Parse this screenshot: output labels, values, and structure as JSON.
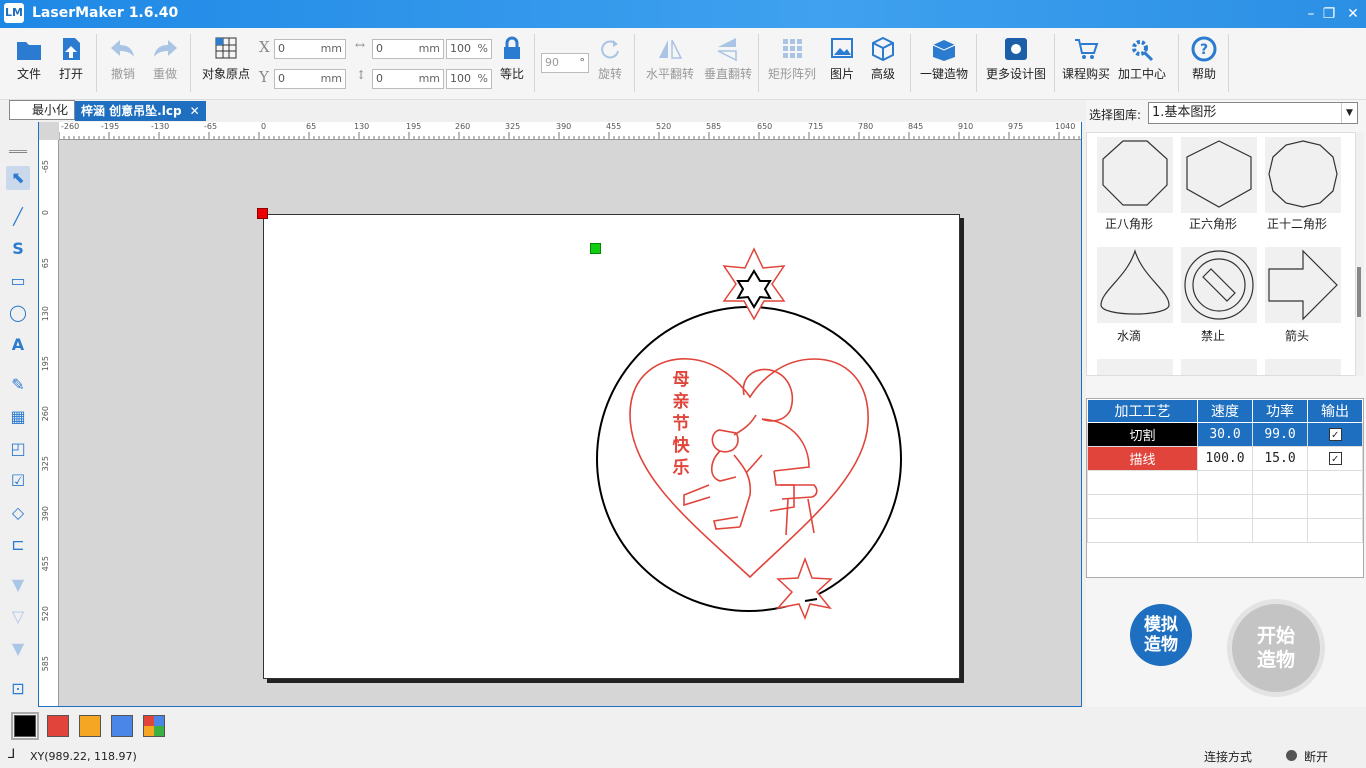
{
  "window": {
    "app_logo": "LM",
    "title": "LaserMaker 1.6.40",
    "minimize": "–",
    "restore": "❐",
    "close": "✕"
  },
  "toolbar": {
    "file": "文件",
    "open": "打开",
    "undo": "撤销",
    "redo": "重做",
    "origin": "对象原点",
    "x_label": "X",
    "y_label": "Y",
    "x_value": "0",
    "y_value": "0",
    "unit": "mm",
    "w_value": "0",
    "h_value": "0",
    "w_pct": "100",
    "h_pct": "100",
    "pct": "%",
    "ratio": "等比",
    "angle": "90",
    "angle_unit": "°",
    "rotate": "旋转",
    "hflip": "水平翻转",
    "vflip": "垂直翻转",
    "array": "矩形阵列",
    "image": "图片",
    "advanced": "高级",
    "oneclick": "一键造物",
    "more_designs": "更多设计图",
    "course": "课程购买",
    "center": "加工中心",
    "help": "帮助"
  },
  "tooltip": "最小化",
  "tab": {
    "title": "梓涵 创意吊坠.lcp",
    "close": "✕"
  },
  "ruler": {
    "h": [
      "-260",
      "-195",
      "-130",
      "-65",
      "0",
      "65",
      "130",
      "195",
      "260",
      "325",
      "390",
      "455",
      "520",
      "585",
      "650",
      "715",
      "780",
      "845",
      "910",
      "975",
      "1040"
    ],
    "v": [
      "-65",
      "0",
      "65",
      "130",
      "195",
      "260",
      "325",
      "390",
      "455",
      "520",
      "585"
    ]
  },
  "artwork": {
    "vertical_text": [
      "母",
      "亲",
      "节",
      "快",
      "乐"
    ],
    "black": "#000000",
    "red": "#e0443a"
  },
  "library": {
    "label": "选择图库:",
    "selected": "1.基本图形",
    "shapes": [
      "正八角形",
      "正六角形",
      "正十二角形",
      "水滴",
      "禁止",
      "箭头"
    ]
  },
  "process": {
    "headers": [
      "加工工艺",
      "速度",
      "功率",
      "输出"
    ],
    "rows": [
      {
        "name": "切割",
        "speed": "30.0",
        "power": "99.0",
        "output": "✓",
        "color": "#000000"
      },
      {
        "name": "描线",
        "speed": "100.0",
        "power": "15.0",
        "output": "✓",
        "color": "#e0443a"
      }
    ]
  },
  "buttons": {
    "simulate_1": "模拟",
    "simulate_2": "造物",
    "start_1": "开始",
    "start_2": "造物"
  },
  "colors": [
    "#000000",
    "#e0443a",
    "#f5a623",
    "#4a86e8",
    "multi"
  ],
  "status": {
    "coords": "XY(989.22, 118.97)",
    "connection_label": "连接方式",
    "connection_state": "断开"
  }
}
